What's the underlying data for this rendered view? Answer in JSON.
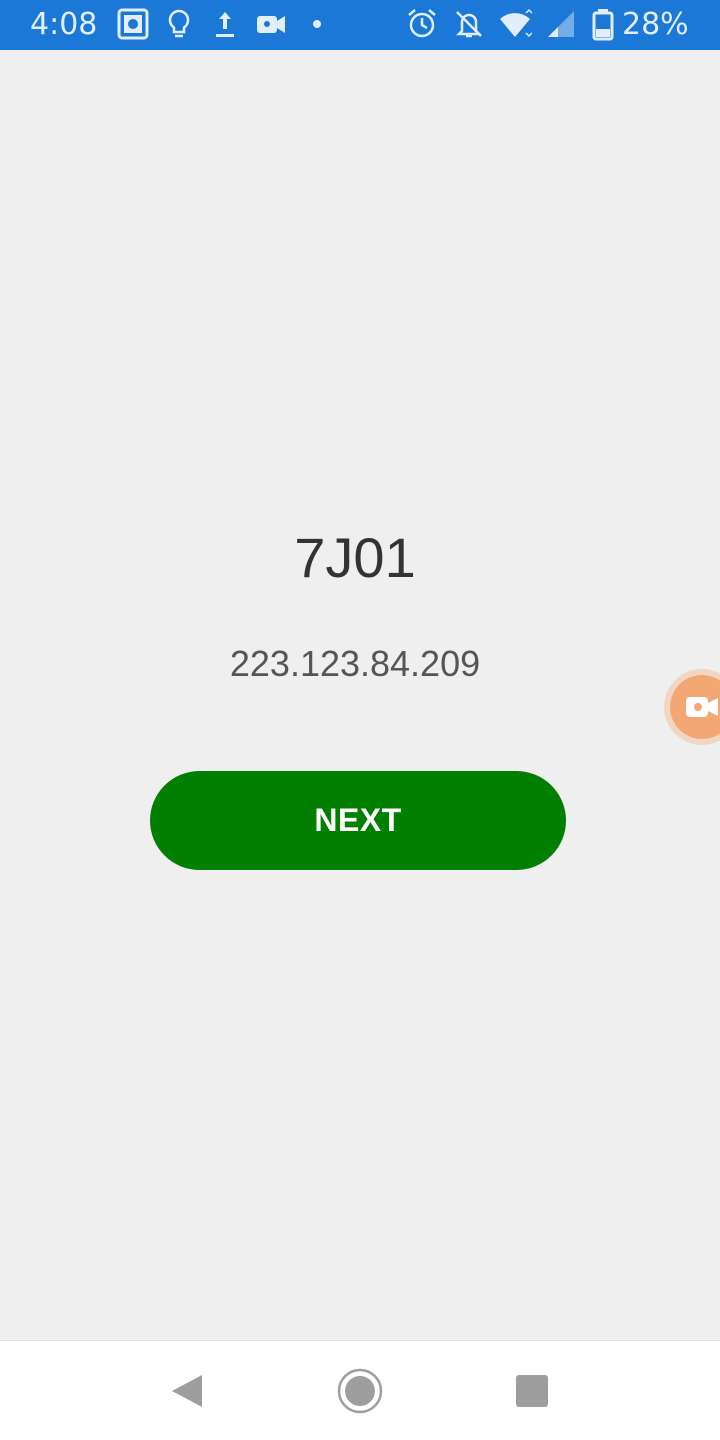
{
  "status_bar": {
    "time": "4:08",
    "battery_percent": "28%",
    "icons": [
      "screenshot-icon",
      "lightbulb-icon",
      "upload-icon",
      "video-camera-icon",
      "dot-icon",
      "alarm-icon",
      "notifications-off-icon",
      "wifi-icon",
      "signal-icon",
      "battery-icon"
    ],
    "color": "#1b78d6"
  },
  "main": {
    "code": "7J01",
    "ip_address": "223.123.84.209",
    "next_label": "NEXT",
    "button_color": "#007f00"
  },
  "nav_bar": {
    "buttons": [
      "back-icon",
      "home-icon",
      "recents-icon"
    ]
  }
}
